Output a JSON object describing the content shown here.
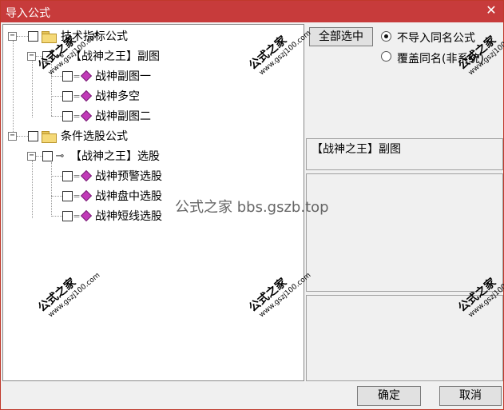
{
  "window": {
    "title": "导入公式",
    "close_glyph": "✕"
  },
  "tree": {
    "nodes": [
      {
        "expander": "−",
        "label": "技术指标公式"
      },
      {
        "expander": "−",
        "label": "【战神之王】副图"
      },
      {
        "label": "战神副图一"
      },
      {
        "label": "战神多空"
      },
      {
        "label": "战神副图二"
      },
      {
        "expander": "−",
        "label": "条件选股公式"
      },
      {
        "expander": "−",
        "label": "【战神之王】选股"
      },
      {
        "label": "战神预警选股"
      },
      {
        "label": "战神盘中选股"
      },
      {
        "label": "战神短线选股"
      }
    ]
  },
  "options": {
    "select_all_label": "全部选中",
    "radio_no_import_label": "不导入同名公式",
    "radio_overwrite_label": "覆盖同名(非系统)",
    "selected_radio": "no_import"
  },
  "info": {
    "selected_formula": "【战神之王】副图"
  },
  "footer": {
    "ok_label": "确定",
    "cancel_label": "取消"
  },
  "watermarks": {
    "brand": "公式之家",
    "site": "www.gszj100.com",
    "center": "公式之家 bbs.gszb.top"
  }
}
